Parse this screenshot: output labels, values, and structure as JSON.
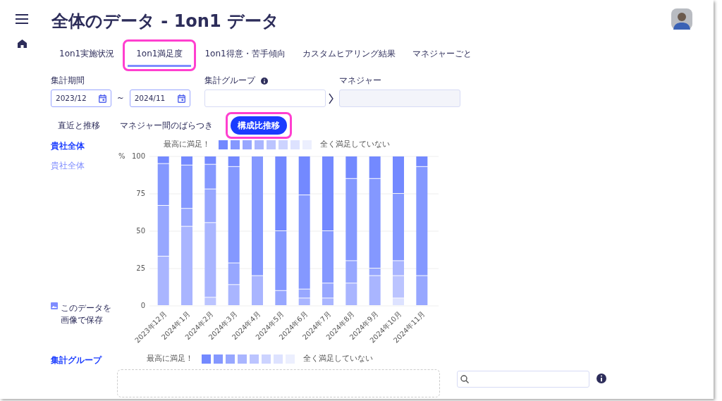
{
  "header": {
    "title": "全体のデータ - 1on1 データ"
  },
  "tabs": [
    {
      "label": "1on1実施状況",
      "selected": false,
      "highlighted": false
    },
    {
      "label": "1on1満足度",
      "selected": true,
      "highlighted": true
    },
    {
      "label": "1on1得意・苦手傾向",
      "selected": false,
      "highlighted": false
    },
    {
      "label": "カスタムヒアリング結果",
      "selected": false,
      "highlighted": false
    },
    {
      "label": "マネジャーごと",
      "selected": false,
      "highlighted": false
    }
  ],
  "filters": {
    "period": {
      "label": "集計期間",
      "from": "2023/12",
      "separator": "~",
      "to": "2024/11"
    },
    "group": {
      "label": "集計グループ"
    },
    "manager": {
      "label": "マネジャー",
      "disabled": true
    }
  },
  "views": [
    {
      "label": "直近と推移",
      "selected": false,
      "highlighted": false
    },
    {
      "label": "マネジャー間のばらつき",
      "selected": false,
      "highlighted": false
    },
    {
      "label": "構成比推移",
      "selected": true,
      "highlighted": true
    }
  ],
  "overall": {
    "heading": "貴社全体",
    "legend": {
      "high_label": "最高に満足！",
      "low_label": "全く満足していない",
      "swatches": [
        {
          "color": "#7389ff"
        },
        {
          "color": "#8498ff"
        },
        {
          "color": "#97a7ff"
        },
        {
          "color": "#a9b5ff"
        },
        {
          "color": "#bbc4ff"
        },
        {
          "color": "#ccd3ff"
        },
        {
          "color": "#dde2ff"
        },
        {
          "color": "#eceffe"
        }
      ]
    },
    "sidebar_item": "貴社全体",
    "save_label": [
      "このデータを",
      "画像で保存"
    ],
    "chart_data": {
      "type": "bar",
      "stacked": true,
      "grid": true,
      "ylabel": "%",
      "ylim": [
        0,
        100
      ],
      "yticks": [
        0,
        25,
        50,
        75,
        100
      ],
      "categories": [
        "2023年12月",
        "2024年1月",
        "2024年2月",
        "2024年3月",
        "2024年4月",
        "2024年5月",
        "2024年6月",
        "2024年7月",
        "2024年8月",
        "2024年9月",
        "2024年10月",
        "2024年11月"
      ],
      "series": [
        {
          "color": "#dde2ff",
          "values": [
            0,
            0,
            0,
            0,
            0,
            0,
            0,
            0,
            0,
            0,
            5,
            0
          ]
        },
        {
          "color": "#bbc4ff",
          "values": [
            0,
            0,
            5.5,
            0,
            0,
            0,
            0,
            0,
            0,
            0,
            15,
            0
          ]
        },
        {
          "color": "#a9b5ff",
          "values": [
            33,
            53,
            50,
            14,
            20,
            0,
            5,
            5,
            15,
            20,
            10,
            0
          ]
        },
        {
          "color": "#97a7ff",
          "values": [
            34,
            12,
            22.5,
            14.5,
            0,
            10,
            6,
            10,
            15,
            5,
            0,
            20
          ]
        },
        {
          "color": "#8498ff",
          "values": [
            28,
            29,
            16.5,
            64.5,
            80,
            40,
            63,
            35,
            55,
            60,
            45,
            73
          ]
        },
        {
          "color": "#7389ff",
          "values": [
            5,
            6,
            5.5,
            7,
            0,
            50,
            26,
            50,
            15,
            15,
            25,
            7
          ]
        }
      ]
    }
  },
  "group_section": {
    "heading": "集計グループ",
    "legend": {
      "high_label": "最高に満足！",
      "low_label": "全く満足していない",
      "swatches": [
        {
          "color": "#7389ff"
        },
        {
          "color": "#8498ff"
        },
        {
          "color": "#97a7ff"
        },
        {
          "color": "#a9b5ff"
        },
        {
          "color": "#bbc4ff"
        },
        {
          "color": "#ccd3ff"
        },
        {
          "color": "#dde2ff"
        },
        {
          "color": "#eceffe"
        }
      ]
    }
  }
}
